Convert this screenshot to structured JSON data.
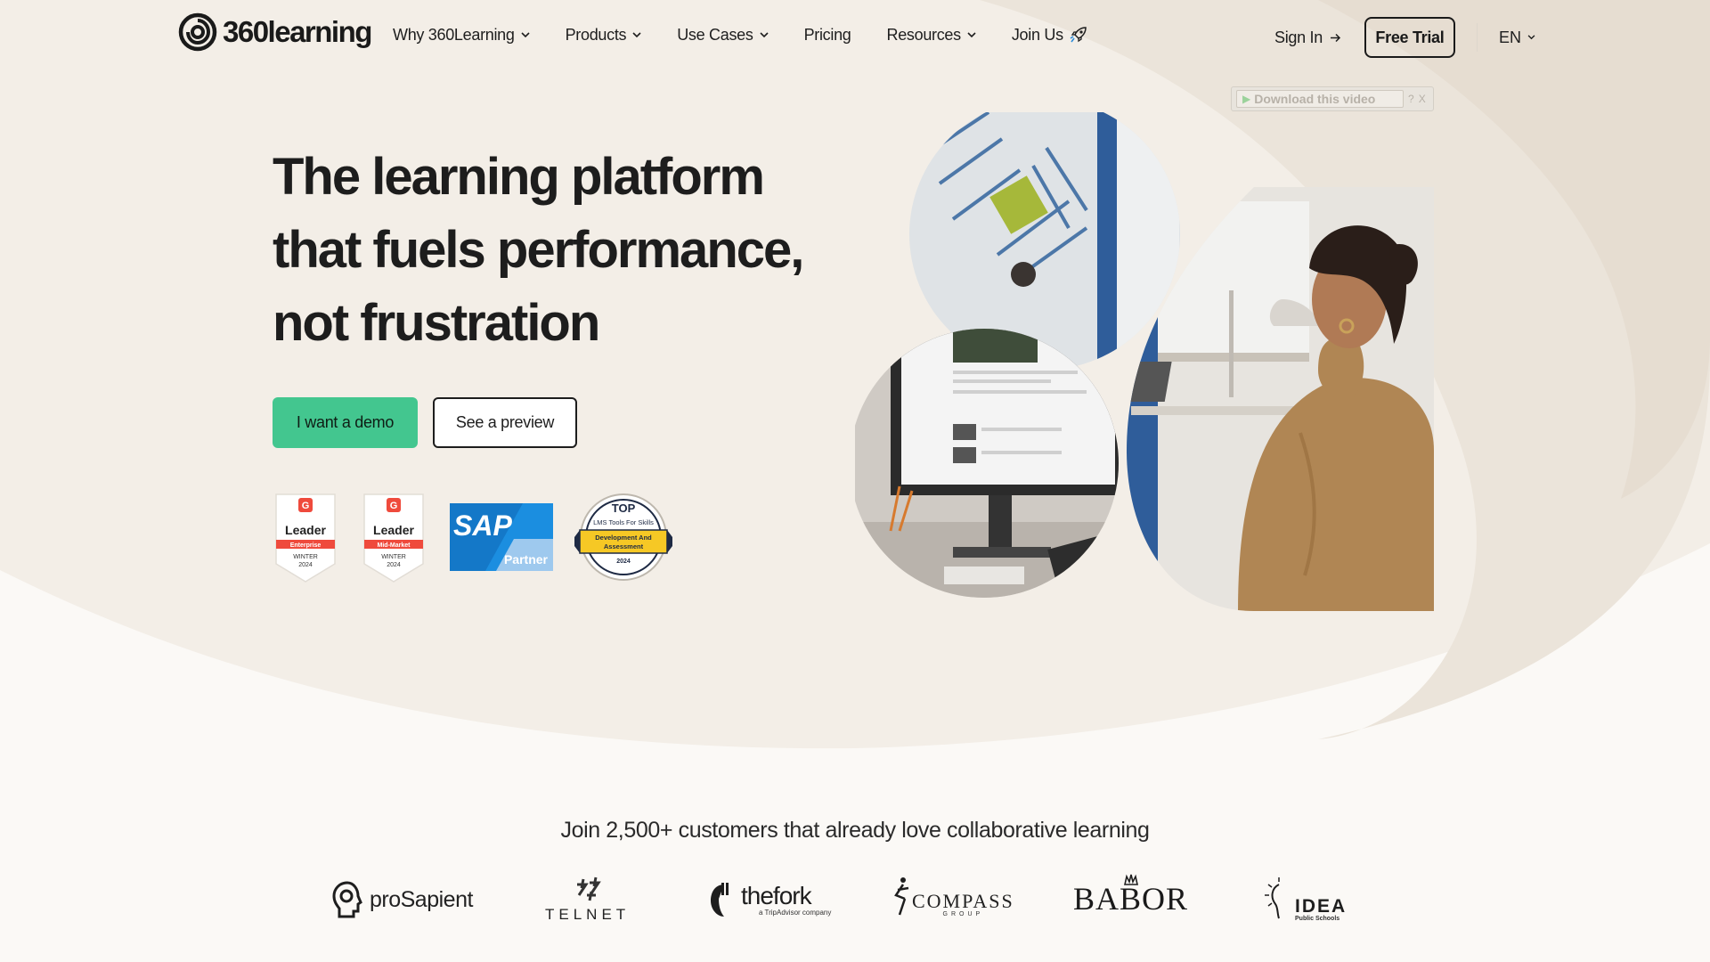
{
  "brand": {
    "name": "360learning"
  },
  "nav": {
    "items": [
      {
        "label": "Why 360Learning",
        "dropdown": true
      },
      {
        "label": "Products",
        "dropdown": true
      },
      {
        "label": "Use Cases",
        "dropdown": true
      },
      {
        "label": "Pricing",
        "dropdown": false
      },
      {
        "label": "Resources",
        "dropdown": true
      },
      {
        "label": "Join Us",
        "dropdown": false,
        "icon": "rocket-icon"
      }
    ],
    "sign_in": "Sign In",
    "free_trial": "Free Trial",
    "language": "EN"
  },
  "video_download": {
    "label": "Download this video",
    "help": "?",
    "close": "X"
  },
  "hero": {
    "title_lines": [
      "The learning platform",
      "that fuels performance,",
      "not frustration"
    ],
    "demo_button": "I want a demo",
    "preview_button": "See a preview"
  },
  "badges": [
    {
      "type": "g2",
      "title": "Leader",
      "segment": "Enterprise",
      "season": "WINTER",
      "year": "2024"
    },
    {
      "type": "g2",
      "title": "Leader",
      "segment": "Mid-Market",
      "season": "WINTER",
      "year": "2024"
    },
    {
      "type": "sap",
      "brand": "SAP",
      "label": "Partner"
    },
    {
      "type": "award",
      "top": "TOP",
      "line1": "LMS Tools For Skills",
      "line2": "Development And",
      "line3": "Assessment",
      "year": "2024"
    }
  ],
  "customers": {
    "title": "Join 2,500+ customers that already love collaborative learning",
    "logos": [
      {
        "name": "proSapient"
      },
      {
        "name": "TELNET"
      },
      {
        "name": "thefork",
        "sub": "a TripAdvisor company"
      },
      {
        "name": "COMPASS",
        "sub": "GROUP"
      },
      {
        "name": "BABOR"
      },
      {
        "name": "IDEA",
        "sub": "Public Schools"
      }
    ]
  },
  "colors": {
    "background": "#f7f3ed",
    "accent_green": "#43c68f",
    "text": "#1d1d1d",
    "g2_red": "#ef4a3c",
    "sap_blue": "#1b8ee0"
  }
}
